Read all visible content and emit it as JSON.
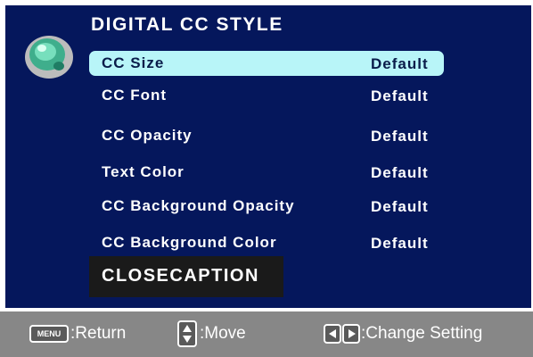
{
  "menu": {
    "title": "DIGITAL CC STYLE",
    "items": [
      {
        "label": "CC Size",
        "value": "Default",
        "selected": true
      },
      {
        "label": "CC Font",
        "value": "Default",
        "selected": false
      },
      {
        "label": "CC Opacity",
        "value": "Default",
        "selected": false
      },
      {
        "label": "Text Color",
        "value": "Default",
        "selected": false
      },
      {
        "label": "CC Background Opacity",
        "value": "Default",
        "selected": false
      },
      {
        "label": "CC Background Color",
        "value": "Default",
        "selected": false
      }
    ],
    "closecaption_label": "CLOSECAPTION",
    "logo_icon": "green-gem-logo-icon"
  },
  "hints": {
    "menu_key": "MENU",
    "return_label": ":Return",
    "move_label": ":Move",
    "change_label": ":Change Setting"
  },
  "colors": {
    "screen_bg": "#05175c",
    "selected_bg": "#b8f5f8",
    "bottom_bar": "#878787",
    "button_bg": "#1a1a1a"
  }
}
